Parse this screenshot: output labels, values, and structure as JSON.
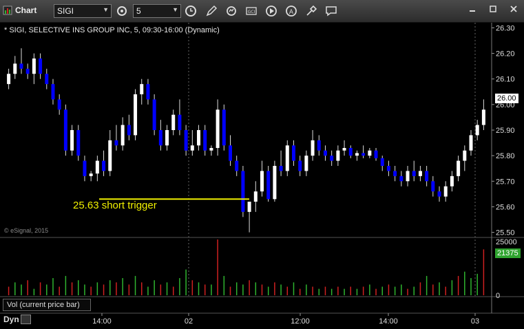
{
  "window": {
    "title": "Chart"
  },
  "toolbar": {
    "symbol_value": "SIGI",
    "interval_value": "5",
    "buttons": [
      "settings-icon",
      "clock-icon",
      "pencil-icon",
      "refresh-icon",
      "gci-icon",
      "play-icon",
      "alert-icon",
      "tools-icon",
      "comment-icon"
    ]
  },
  "chart": {
    "title": "* SIGI, SELECTIVE INS GROUP INC, 5, 09:30-16:00 (Dynamic)",
    "watermark": "© eSignal, 2015",
    "annotation": "25.63 short trigger",
    "trigger_price": 25.63,
    "current_price_tag": "26.00",
    "volume_tag": "21375",
    "volume_label": "Vol (current price bar)",
    "mode_label": "Dyn",
    "colors": {
      "up": "#ffffff",
      "down": "#0000ff",
      "annotation": "#f0f000",
      "vol_up": "#2fb52f",
      "vol_down": "#d02020"
    }
  },
  "chart_data": {
    "type": "candlestick",
    "price_axis": {
      "ticks": [
        "26.30",
        "26.20",
        "26.10",
        "26.00",
        "25.90",
        "25.80",
        "25.70",
        "25.60",
        "25.50"
      ],
      "ylim": [
        25.48,
        26.32
      ]
    },
    "volume_axis": {
      "ticks": [
        "25000",
        "0"
      ]
    },
    "time_axis": {
      "ticks": [
        "14:00",
        "02",
        "12:00",
        "14:00",
        "03"
      ]
    },
    "candles": [
      [
        26.08,
        26.14,
        26.06,
        26.12
      ],
      [
        26.12,
        26.19,
        26.1,
        26.16
      ],
      [
        26.16,
        26.22,
        26.12,
        26.14
      ],
      [
        26.14,
        26.16,
        26.1,
        26.12
      ],
      [
        26.12,
        26.2,
        26.08,
        26.18
      ],
      [
        26.18,
        26.2,
        26.1,
        26.12
      ],
      [
        26.12,
        26.14,
        26.06,
        26.08
      ],
      [
        26.08,
        26.1,
        26.0,
        26.02
      ],
      [
        26.02,
        26.04,
        25.96,
        25.98
      ],
      [
        25.98,
        26.0,
        25.8,
        25.82
      ],
      [
        25.82,
        25.92,
        25.8,
        25.9
      ],
      [
        25.9,
        25.92,
        25.78,
        25.8
      ],
      [
        25.78,
        25.8,
        25.7,
        25.72
      ],
      [
        25.72,
        25.74,
        25.7,
        25.73
      ],
      [
        25.73,
        25.8,
        25.7,
        25.78
      ],
      [
        25.78,
        25.82,
        25.72,
        25.74
      ],
      [
        25.74,
        25.9,
        25.72,
        25.86
      ],
      [
        25.86,
        25.92,
        25.82,
        25.84
      ],
      [
        25.84,
        25.95,
        25.82,
        25.92
      ],
      [
        25.92,
        25.96,
        25.86,
        25.88
      ],
      [
        25.88,
        26.06,
        25.86,
        26.04
      ],
      [
        26.04,
        26.1,
        26.0,
        26.08
      ],
      [
        26.08,
        26.1,
        26.0,
        26.02
      ],
      [
        26.02,
        26.04,
        25.88,
        25.9
      ],
      [
        25.9,
        25.94,
        25.82,
        25.84
      ],
      [
        25.84,
        25.92,
        25.82,
        25.9
      ],
      [
        25.9,
        25.98,
        25.88,
        25.96
      ],
      [
        25.96,
        26.02,
        25.88,
        25.9
      ],
      [
        25.9,
        25.92,
        25.8,
        25.82
      ],
      [
        25.82,
        25.9,
        25.8,
        25.84
      ],
      [
        25.84,
        25.92,
        25.82,
        25.9
      ],
      [
        25.9,
        25.92,
        25.8,
        25.82
      ],
      [
        25.82,
        25.84,
        25.8,
        25.83
      ],
      [
        25.83,
        26.02,
        25.8,
        25.98
      ],
      [
        25.98,
        26.0,
        25.82,
        25.84
      ],
      [
        25.84,
        25.88,
        25.76,
        25.78
      ],
      [
        25.78,
        25.8,
        25.72,
        25.74
      ],
      [
        25.74,
        25.76,
        25.56,
        25.58
      ],
      [
        25.58,
        25.6,
        25.5,
        25.62
      ],
      [
        25.62,
        25.7,
        25.58,
        25.66
      ],
      [
        25.66,
        25.78,
        25.64,
        25.74
      ],
      [
        25.74,
        25.76,
        25.62,
        25.63
      ],
      [
        25.63,
        25.78,
        25.62,
        25.76
      ],
      [
        25.76,
        25.82,
        25.72,
        25.74
      ],
      [
        25.74,
        25.86,
        25.72,
        25.84
      ],
      [
        25.84,
        25.86,
        25.76,
        25.78
      ],
      [
        25.78,
        25.8,
        25.72,
        25.74
      ],
      [
        25.74,
        25.82,
        25.72,
        25.8
      ],
      [
        25.8,
        25.9,
        25.78,
        25.86
      ],
      [
        25.86,
        25.88,
        25.8,
        25.82
      ],
      [
        25.82,
        25.84,
        25.78,
        25.8
      ],
      [
        25.8,
        25.82,
        25.76,
        25.78
      ],
      [
        25.78,
        25.84,
        25.76,
        25.82
      ],
      [
        25.82,
        25.86,
        25.8,
        25.83
      ],
      [
        25.83,
        25.84,
        25.79,
        25.8
      ],
      [
        25.8,
        25.82,
        25.78,
        25.81
      ],
      [
        25.81,
        25.84,
        25.79,
        25.8
      ],
      [
        25.8,
        25.83,
        25.79,
        25.82
      ],
      [
        25.82,
        25.83,
        25.78,
        25.79
      ],
      [
        25.79,
        25.8,
        25.74,
        25.76
      ],
      [
        25.76,
        25.78,
        25.72,
        25.74
      ],
      [
        25.74,
        25.76,
        25.7,
        25.72
      ],
      [
        25.72,
        25.74,
        25.68,
        25.7
      ],
      [
        25.7,
        25.76,
        25.68,
        25.74
      ],
      [
        25.74,
        25.78,
        25.7,
        25.72
      ],
      [
        25.72,
        25.76,
        25.7,
        25.74
      ],
      [
        25.74,
        25.76,
        25.68,
        25.7
      ],
      [
        25.7,
        25.72,
        25.64,
        25.66
      ],
      [
        25.66,
        25.68,
        25.62,
        25.64
      ],
      [
        25.64,
        25.7,
        25.62,
        25.68
      ],
      [
        25.68,
        25.74,
        25.66,
        25.72
      ],
      [
        25.72,
        25.8,
        25.7,
        25.78
      ],
      [
        25.78,
        25.84,
        25.74,
        25.82
      ],
      [
        25.82,
        25.9,
        25.8,
        25.88
      ],
      [
        25.88,
        25.94,
        25.86,
        25.92
      ],
      [
        25.92,
        26.02,
        25.9,
        25.98
      ]
    ],
    "volume": [
      [
        4000,
        0
      ],
      [
        6000,
        1
      ],
      [
        5000,
        1
      ],
      [
        7000,
        0
      ],
      [
        3000,
        1
      ],
      [
        6000,
        0
      ],
      [
        5000,
        1
      ],
      [
        8000,
        1
      ],
      [
        4000,
        0
      ],
      [
        9000,
        1
      ],
      [
        6000,
        0
      ],
      [
        7000,
        1
      ],
      [
        5000,
        1
      ],
      [
        4000,
        0
      ],
      [
        6000,
        1
      ],
      [
        5000,
        0
      ],
      [
        7000,
        1
      ],
      [
        6000,
        0
      ],
      [
        8000,
        1
      ],
      [
        5000,
        0
      ],
      [
        9000,
        1
      ],
      [
        6000,
        0
      ],
      [
        4000,
        1
      ],
      [
        7000,
        1
      ],
      [
        5000,
        0
      ],
      [
        6000,
        1
      ],
      [
        4000,
        0
      ],
      [
        8000,
        1
      ],
      [
        12000,
        1
      ],
      [
        7000,
        0
      ],
      [
        6000,
        1
      ],
      [
        5000,
        0
      ],
      [
        5000,
        1
      ],
      [
        26000,
        0
      ],
      [
        9000,
        1
      ],
      [
        4000,
        0
      ],
      [
        6000,
        1
      ],
      [
        5000,
        1
      ],
      [
        7000,
        0
      ],
      [
        6000,
        1
      ],
      [
        5000,
        0
      ],
      [
        4000,
        1
      ],
      [
        6000,
        0
      ],
      [
        5000,
        1
      ],
      [
        4000,
        0
      ],
      [
        6000,
        1
      ],
      [
        3000,
        0
      ],
      [
        5000,
        1
      ],
      [
        4000,
        0
      ],
      [
        3000,
        1
      ],
      [
        4000,
        0
      ],
      [
        3000,
        1
      ],
      [
        4000,
        0
      ],
      [
        3000,
        1
      ],
      [
        4000,
        0
      ],
      [
        3000,
        1
      ],
      [
        4000,
        0
      ],
      [
        5000,
        1
      ],
      [
        3000,
        0
      ],
      [
        4000,
        1
      ],
      [
        5000,
        0
      ],
      [
        4000,
        1
      ],
      [
        5000,
        1
      ],
      [
        3000,
        0
      ],
      [
        4000,
        1
      ],
      [
        6000,
        0
      ],
      [
        9000,
        1
      ],
      [
        5000,
        0
      ],
      [
        6000,
        1
      ],
      [
        4000,
        0
      ],
      [
        7000,
        1
      ],
      [
        9000,
        0
      ],
      [
        11000,
        1
      ],
      [
        8000,
        1
      ],
      [
        10000,
        1
      ],
      [
        21375,
        0
      ]
    ]
  }
}
